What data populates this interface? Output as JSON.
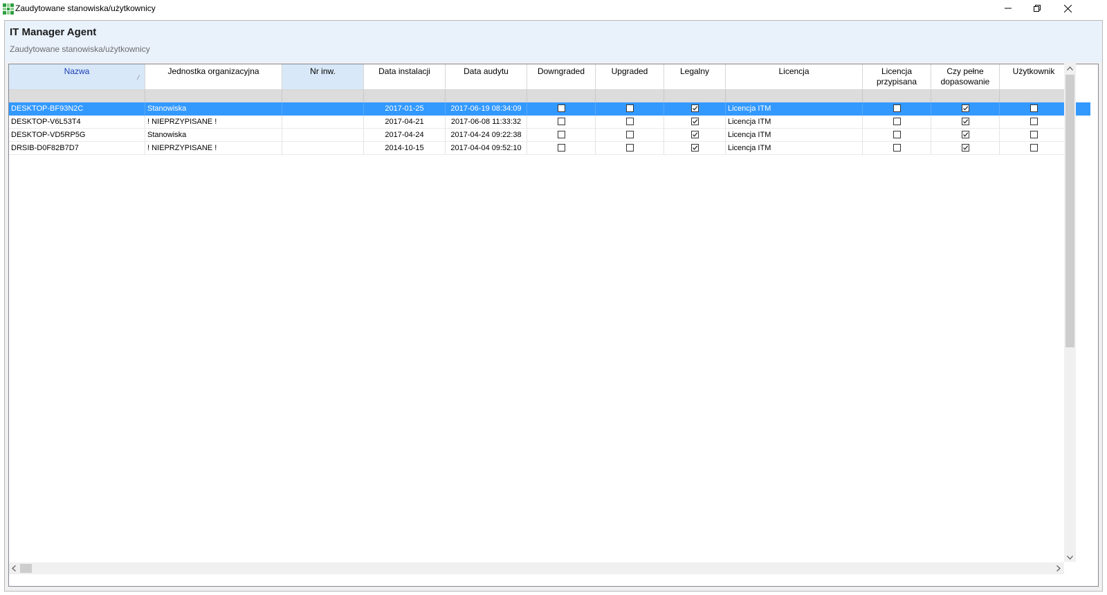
{
  "window": {
    "title": "Zaudytowane stanowiska/użytkownicy",
    "icons": [
      "app-grid-icon",
      "minimize-icon",
      "restore-icon",
      "close-icon"
    ]
  },
  "header": {
    "app_title": "IT Manager Agent",
    "subtitle": "Zaudytowane stanowiska/użytkownicy"
  },
  "grid": {
    "columns": [
      {
        "key": "nazwa",
        "label": "Nazwa"
      },
      {
        "key": "jednostka",
        "label": "Jednostka organizacyjna"
      },
      {
        "key": "nrinw",
        "label": "Nr inw."
      },
      {
        "key": "data_instalacji",
        "label": "Data instalacji"
      },
      {
        "key": "data_audytu",
        "label": "Data audytu"
      },
      {
        "key": "downgraded",
        "label": "Downgraded"
      },
      {
        "key": "upgraded",
        "label": "Upgraded"
      },
      {
        "key": "legalny",
        "label": "Legalny"
      },
      {
        "key": "licencja",
        "label": "Licencja"
      },
      {
        "key": "licencja_przypisana",
        "label": "Licencja przypisana"
      },
      {
        "key": "pelne_dopasowanie",
        "label": "Czy pełne dopasowanie"
      },
      {
        "key": "uzytkownik",
        "label": "Użytkownik"
      }
    ],
    "sorted_column": "Nazwa",
    "rows": [
      {
        "nazwa": "DESKTOP-BF93N2C",
        "jednostka": "Stanowiska",
        "nrinw": "",
        "data_instalacji": "2017-01-25",
        "data_audytu": "2017-06-19 08:34:09",
        "downgraded": false,
        "upgraded": false,
        "legalny": true,
        "licencja": "Licencja ITM",
        "licencja_przypisana": false,
        "pelne_dopasowanie": true,
        "uzytkownik": false,
        "selected": true
      },
      {
        "nazwa": "DESKTOP-V6L53T4",
        "jednostka": "! NIEPRZYPISANE !",
        "nrinw": "",
        "data_instalacji": "2017-04-21",
        "data_audytu": "2017-06-08 11:33:32",
        "downgraded": false,
        "upgraded": false,
        "legalny": true,
        "licencja": "Licencja ITM",
        "licencja_przypisana": false,
        "pelne_dopasowanie": true,
        "uzytkownik": false,
        "selected": false
      },
      {
        "nazwa": "DESKTOP-VD5RP5G",
        "jednostka": "Stanowiska",
        "nrinw": "",
        "data_instalacji": "2017-04-24",
        "data_audytu": "2017-04-24 09:22:38",
        "downgraded": false,
        "upgraded": false,
        "legalny": true,
        "licencja": "Licencja ITM",
        "licencja_przypisana": false,
        "pelne_dopasowanie": true,
        "uzytkownik": false,
        "selected": false
      },
      {
        "nazwa": "DRSIB-D0F82B7D7",
        "jednostka": "! NIEPRZYPISANE !",
        "nrinw": "",
        "data_instalacji": "2014-10-15",
        "data_audytu": "2017-04-04 09:52:10",
        "downgraded": false,
        "upgraded": false,
        "legalny": true,
        "licencja": "Licencja ITM",
        "licencja_przypisana": false,
        "pelne_dopasowanie": true,
        "uzytkownik": false,
        "selected": false
      }
    ]
  },
  "scrollbars": {
    "icons": [
      "scroll-up-arrow-icon",
      "scroll-down-arrow-icon",
      "scroll-left-arrow-icon",
      "scroll-right-arrow-icon"
    ]
  }
}
